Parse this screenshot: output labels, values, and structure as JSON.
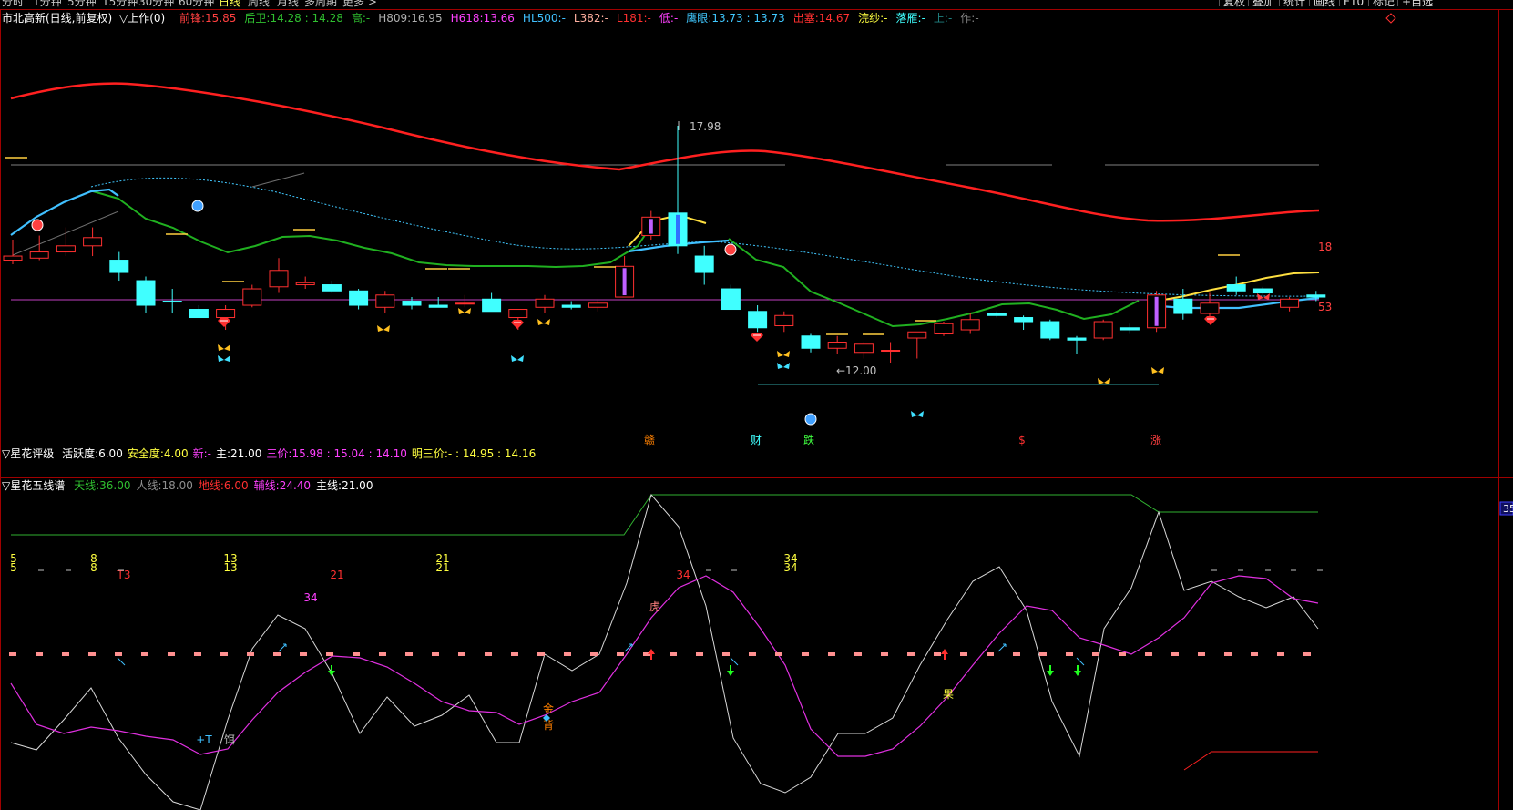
{
  "toolbar": {
    "timeframes": [
      "分时",
      "1分钟",
      "5分钟",
      "15分钟",
      "30分钟",
      "60分钟",
      "日线",
      "周线",
      "月线",
      "多周期",
      "更多 >"
    ],
    "active_index": 6,
    "right_buttons": [
      "复权",
      "叠加",
      "统计",
      "画线",
      "F10",
      "标记",
      "+自选"
    ]
  },
  "header": {
    "stock": "市北高新(日线,前复权)",
    "mode": "▽上作(0)",
    "items": [
      {
        "label": "前锋:",
        "value": "15.85",
        "color": "#ff4040"
      },
      {
        "label": "后卫:",
        "value": "14.28 : 14.28",
        "color": "#30c030"
      },
      {
        "label": "高:",
        "value": "-",
        "color": "#30c030"
      },
      {
        "label": "H809:",
        "value": "16.95",
        "color": "#b0b0b0"
      },
      {
        "label": "H618:",
        "value": "13.66",
        "color": "#ff40ff"
      },
      {
        "label": "HL500:",
        "value": "-",
        "color": "#40c0ff"
      },
      {
        "label": "L382:",
        "value": "-",
        "color": "#ffb0a0"
      },
      {
        "label": "L181:",
        "value": "-",
        "color": "#ff3030"
      },
      {
        "label": "低:",
        "value": "-",
        "color": "#ff40ff"
      },
      {
        "label": "鹰眼:",
        "value": "13.73 : 13.73",
        "color": "#40c8ff"
      },
      {
        "label": "出塞:",
        "value": "14.67",
        "color": "#ff3030"
      },
      {
        "label": "浣纱:",
        "value": "-",
        "color": "#ffff40"
      },
      {
        "label": "落雁:",
        "value": "-",
        "color": "#40ffff"
      },
      {
        "label": "上:",
        "value": "-",
        "color": "#208080"
      },
      {
        "label": "作:",
        "value": "-",
        "color": "#808080"
      }
    ]
  },
  "price_panel": {
    "high_label": "17.98",
    "low_label": "←12.00",
    "right_labels": [
      "18",
      "53"
    ],
    "bottom_marks": [
      {
        "text": "赣",
        "color": "#ff8000"
      },
      {
        "text": "财",
        "color": "#40ffff"
      },
      {
        "text": "跌",
        "color": "#40ff40"
      },
      {
        "text": "$",
        "color": "#ff3030"
      },
      {
        "text": "涨",
        "color": "#ff4040"
      }
    ]
  },
  "rating_panel": {
    "title": "▽星花评级",
    "items": [
      {
        "label": "活跃度:",
        "value": "6.00",
        "color": "#ffffff"
      },
      {
        "label": "安全度:",
        "value": "4.00",
        "color": "#ffff40"
      },
      {
        "label": "新:",
        "value": "-",
        "color": "#ff40ff"
      },
      {
        "label": "主:",
        "value": "21.00",
        "color": "#ffffff"
      },
      {
        "label": "三价:",
        "value": "15.98 : 15.04 : 14.10",
        "color": "#ff40ff"
      },
      {
        "label": "明三价:",
        "value": "- : 14.95 : 14.16",
        "color": "#ffff40"
      }
    ]
  },
  "lines_panel": {
    "title": "▽星花五线谱",
    "items": [
      {
        "label": "天线:",
        "value": "36.00",
        "color": "#30c030"
      },
      {
        "label": "人线:",
        "value": "18.00",
        "color": "#909090"
      },
      {
        "label": "地线:",
        "value": "6.00",
        "color": "#ff3030"
      },
      {
        "label": "辅线:",
        "value": "24.40",
        "color": "#ff40ff"
      },
      {
        "label": "主线:",
        "value": "21.00",
        "color": "#ffffff"
      }
    ],
    "axis_label": "35",
    "numbers": [
      {
        "text": "5",
        "color": "#ffff40"
      },
      {
        "text": "5",
        "color": "#ffff40"
      },
      {
        "text": "8",
        "color": "#ffff40"
      },
      {
        "text": "8",
        "color": "#ffff40"
      },
      {
        "text": "13",
        "color": "#ffff40"
      },
      {
        "text": "13",
        "color": "#ffff40"
      },
      {
        "text": "21",
        "color": "#ffff40"
      },
      {
        "text": "21",
        "color": "#ffff40"
      },
      {
        "text": "34",
        "color": "#ffff40"
      },
      {
        "text": "34",
        "color": "#ffff40"
      },
      {
        "text": "T3",
        "color": "#ff3030"
      },
      {
        "text": "21",
        "color": "#ff3030"
      },
      {
        "text": "34",
        "color": "#ff40ff"
      },
      {
        "text": "34",
        "color": "#ff3030"
      }
    ],
    "chars": [
      {
        "text": "虎",
        "color": "#ff8080"
      },
      {
        "text": "金",
        "color": "#ff8000"
      },
      {
        "text": "背",
        "color": "#ff8000"
      },
      {
        "text": "果",
        "color": "#ffff40"
      },
      {
        "text": "+T",
        "color": "#40c0ff"
      },
      {
        "text": "饵",
        "color": "#c0c0c0"
      }
    ]
  },
  "chart_data": {
    "type": "candlestick",
    "candles": [
      {
        "o": 14.8,
        "h": 15.2,
        "l": 14.6,
        "c": 14.7,
        "up": true
      },
      {
        "o": 14.75,
        "h": 15.3,
        "l": 14.7,
        "c": 14.9,
        "up": true
      },
      {
        "o": 14.9,
        "h": 15.5,
        "l": 14.8,
        "c": 15.05,
        "up": true
      },
      {
        "o": 15.05,
        "h": 15.5,
        "l": 14.8,
        "c": 15.25,
        "up": true
      },
      {
        "o": 14.7,
        "h": 14.9,
        "l": 14.2,
        "c": 14.4,
        "up": false
      },
      {
        "o": 14.2,
        "h": 14.3,
        "l": 13.4,
        "c": 13.6,
        "up": false
      },
      {
        "o": 13.7,
        "h": 14.0,
        "l": 13.4,
        "c": 13.7,
        "up": false
      },
      {
        "o": 13.5,
        "h": 13.6,
        "l": 13.3,
        "c": 13.3,
        "up": false
      },
      {
        "o": 13.3,
        "h": 13.6,
        "l": 13.0,
        "c": 13.5,
        "up": true
      },
      {
        "o": 13.6,
        "h": 14.1,
        "l": 13.55,
        "c": 14.0,
        "up": true
      },
      {
        "o": 14.05,
        "h": 14.75,
        "l": 13.9,
        "c": 14.45,
        "up": true
      },
      {
        "o": 14.1,
        "h": 14.3,
        "l": 14.0,
        "c": 14.15,
        "up": true
      },
      {
        "o": 14.1,
        "h": 14.2,
        "l": 13.9,
        "c": 13.95,
        "up": false
      },
      {
        "o": 13.95,
        "h": 14.0,
        "l": 13.5,
        "c": 13.6,
        "up": false
      },
      {
        "o": 13.55,
        "h": 13.95,
        "l": 13.4,
        "c": 13.85,
        "up": true
      },
      {
        "o": 13.7,
        "h": 13.8,
        "l": 13.5,
        "c": 13.6,
        "up": false
      },
      {
        "o": 13.6,
        "h": 13.8,
        "l": 13.55,
        "c": 13.55,
        "up": false
      },
      {
        "o": 13.65,
        "h": 13.85,
        "l": 13.55,
        "c": 13.65,
        "up": true
      },
      {
        "o": 13.75,
        "h": 13.9,
        "l": 13.45,
        "c": 13.45,
        "up": false
      },
      {
        "o": 13.3,
        "h": 13.4,
        "l": 13.0,
        "c": 13.5,
        "up": true
      },
      {
        "o": 13.55,
        "h": 13.85,
        "l": 13.4,
        "c": 13.75,
        "up": true
      },
      {
        "o": 13.6,
        "h": 13.7,
        "l": 13.5,
        "c": 13.55,
        "up": false
      },
      {
        "o": 13.55,
        "h": 13.75,
        "l": 13.45,
        "c": 13.65,
        "up": true
      },
      {
        "o": 13.8,
        "h": 14.8,
        "l": 13.8,
        "c": 14.55,
        "up": true
      },
      {
        "o": 15.3,
        "h": 15.9,
        "l": 15.2,
        "c": 15.75,
        "up": true
      },
      {
        "o": 15.85,
        "h": 17.98,
        "l": 14.85,
        "c": 15.05,
        "up": false
      },
      {
        "o": 14.8,
        "h": 15.05,
        "l": 14.1,
        "c": 14.4,
        "up": false
      },
      {
        "o": 14.0,
        "h": 14.1,
        "l": 13.55,
        "c": 13.5,
        "up": false
      },
      {
        "o": 13.45,
        "h": 13.6,
        "l": 12.95,
        "c": 13.05,
        "up": false
      },
      {
        "o": 13.1,
        "h": 13.45,
        "l": 12.95,
        "c": 13.35,
        "up": true
      },
      {
        "o": 12.85,
        "h": 12.9,
        "l": 12.45,
        "c": 12.55,
        "up": false
      },
      {
        "o": 12.55,
        "h": 12.85,
        "l": 12.4,
        "c": 12.7,
        "up": true
      },
      {
        "o": 12.45,
        "h": 12.7,
        "l": 12.3,
        "c": 12.65,
        "up": true
      },
      {
        "o": 12.5,
        "h": 12.7,
        "l": 12.2,
        "c": 12.5,
        "up": true
      },
      {
        "o": 12.8,
        "h": 12.95,
        "l": 12.3,
        "c": 12.95,
        "up": true
      },
      {
        "o": 12.9,
        "h": 13.2,
        "l": 12.85,
        "c": 13.15,
        "up": true
      },
      {
        "o": 13.0,
        "h": 13.4,
        "l": 12.9,
        "c": 13.25,
        "up": true
      },
      {
        "o": 13.4,
        "h": 13.45,
        "l": 13.3,
        "c": 13.35,
        "up": false
      },
      {
        "o": 13.3,
        "h": 13.35,
        "l": 13.0,
        "c": 13.2,
        "up": false
      },
      {
        "o": 13.2,
        "h": 13.25,
        "l": 12.75,
        "c": 12.8,
        "up": false
      },
      {
        "o": 12.8,
        "h": 12.85,
        "l": 12.4,
        "c": 12.75,
        "up": false
      },
      {
        "o": 13.2,
        "h": 13.25,
        "l": 12.75,
        "c": 12.8,
        "up": true
      },
      {
        "o": 13.05,
        "h": 13.15,
        "l": 12.9,
        "c": 13.0,
        "up": false
      },
      {
        "o": 13.05,
        "h": 13.95,
        "l": 12.95,
        "c": 13.85,
        "up": true
      },
      {
        "o": 13.4,
        "h": 14.0,
        "l": 13.25,
        "c": 13.75,
        "up": false
      },
      {
        "o": 13.4,
        "h": 13.9,
        "l": 13.3,
        "c": 13.65,
        "up": true
      },
      {
        "o": 13.95,
        "h": 14.3,
        "l": 13.85,
        "c": 14.1,
        "up": false
      },
      {
        "o": 14.0,
        "h": 14.05,
        "l": 13.85,
        "c": 13.9,
        "up": false
      },
      {
        "o": 13.55,
        "h": 13.8,
        "l": 13.45,
        "c": 13.75,
        "up": true
      },
      {
        "o": 13.85,
        "h": 13.95,
        "l": 13.7,
        "c": 13.8,
        "up": false
      }
    ],
    "lines_note": "moving-average style overlays drawn in red, cyan, dotted cyan, green, yellow"
  }
}
